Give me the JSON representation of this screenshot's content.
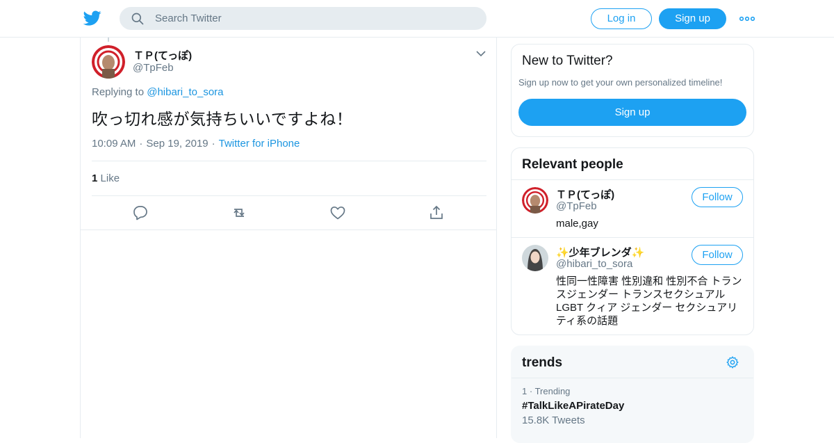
{
  "header": {
    "logo": "twitter-bird-icon",
    "search_placeholder": "Search Twitter",
    "login_label": "Log in",
    "signup_label": "Sign up",
    "more_icon": "more-dots-icon",
    "brand_color": "#1da1f2"
  },
  "tweet": {
    "author_name": "ＴＰ(てっぽ)",
    "author_handle": "@TpFeb",
    "replying_prefix": "Replying to",
    "replying_to": "@hibari_to_sora",
    "text": "吹っ切れ感が気持ちいいですよね！",
    "time": "10:09 AM",
    "date": "Sep 19, 2019",
    "source": "Twitter for iPhone",
    "like_count": "1",
    "like_label": "Like",
    "actions": [
      "reply-icon",
      "retweet-icon",
      "like-icon",
      "share-icon"
    ]
  },
  "new_to_twitter": {
    "title": "New to Twitter?",
    "subtitle": "Sign up now to get your own personalized timeline!",
    "signup_label": "Sign up"
  },
  "relevant_people": {
    "title": "Relevant people",
    "people": [
      {
        "name": "ＴＰ(てっぽ)",
        "handle": "@TpFeb",
        "bio": "male,gay",
        "follow_label": "Follow"
      },
      {
        "name": "✨少年ブレンダ✨",
        "handle": "@hibari_to_sora",
        "bio": "性同一性障害 性別違和 性別不合 トランスジェンダー トランスセクシュアル LGBT クィア ジェンダー セクシュアリティ系の話題",
        "follow_label": "Follow"
      }
    ]
  },
  "trends": {
    "title": "trends",
    "items": [
      {
        "rank": "1",
        "context": "Trending",
        "name": "#TalkLikeAPirateDay",
        "count": "15.8K Tweets"
      }
    ]
  }
}
